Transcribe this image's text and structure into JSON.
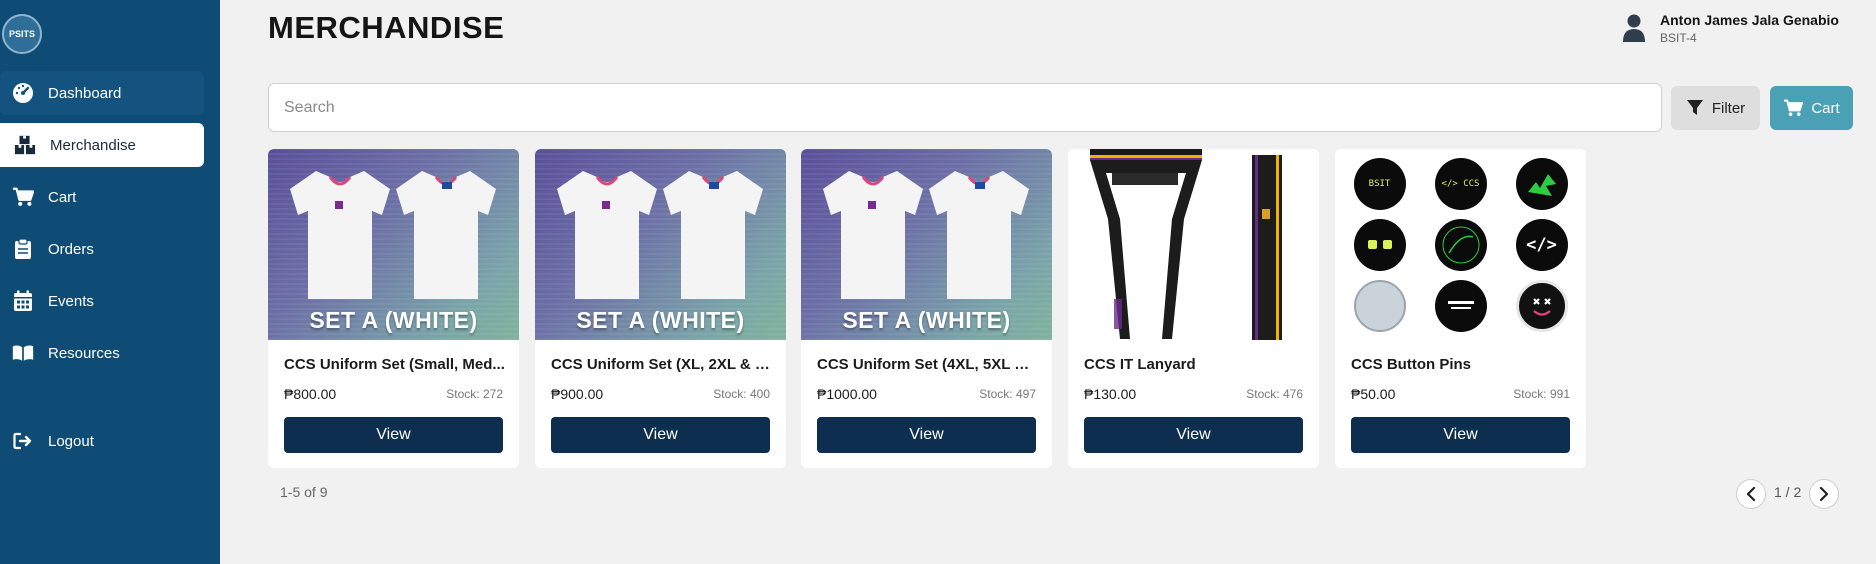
{
  "app": {
    "logo_text": "PSITS"
  },
  "sidebar": {
    "items": [
      {
        "label": "Dashboard",
        "icon": "gauge-icon"
      },
      {
        "label": "Merchandise",
        "icon": "boxes-icon"
      },
      {
        "label": "Cart",
        "icon": "cart-icon"
      },
      {
        "label": "Orders",
        "icon": "clipboard-icon"
      },
      {
        "label": "Events",
        "icon": "calendar-icon"
      },
      {
        "label": "Resources",
        "icon": "book-icon"
      }
    ],
    "logout_label": "Logout"
  },
  "header": {
    "title": "MERCHANDISE",
    "user_name": "Anton James Jala Genabio",
    "user_sub": "BSIT-4"
  },
  "search": {
    "placeholder": "Search",
    "value": ""
  },
  "toolbar": {
    "filter_label": "Filter",
    "cart_label": "Cart"
  },
  "products": [
    {
      "title": "CCS Uniform Set (Small, Med...",
      "price": "₱800.00",
      "stock": "Stock: 272",
      "image_text": "SET A (WHITE)",
      "view_label": "View"
    },
    {
      "title": "CCS Uniform Set (XL, 2XL & 3...",
      "price": "₱900.00",
      "stock": "Stock: 400",
      "image_text": "SET A (WHITE)",
      "view_label": "View"
    },
    {
      "title": "CCS Uniform Set (4XL, 5XL & ...",
      "price": "₱1000.00",
      "stock": "Stock: 497",
      "image_text": "SET A (WHITE)",
      "view_label": "View"
    },
    {
      "title": "CCS IT Lanyard",
      "price": "₱130.00",
      "stock": "Stock: 476",
      "view_label": "View"
    },
    {
      "title": "CCS Button Pins",
      "price": "₱50.00",
      "stock": "Stock: 991",
      "view_label": "View",
      "pins": [
        "BSIT",
        "</> CCS",
        "",
        "",
        "",
        "</>",
        "",
        "",
        ""
      ]
    }
  ],
  "pagination": {
    "range": "1-5 of 9",
    "page": "1 / 2"
  },
  "colors": {
    "sidebar": "#0f4c75",
    "accent": "#4aa0b5",
    "button_dark": "#0d2e4e"
  }
}
